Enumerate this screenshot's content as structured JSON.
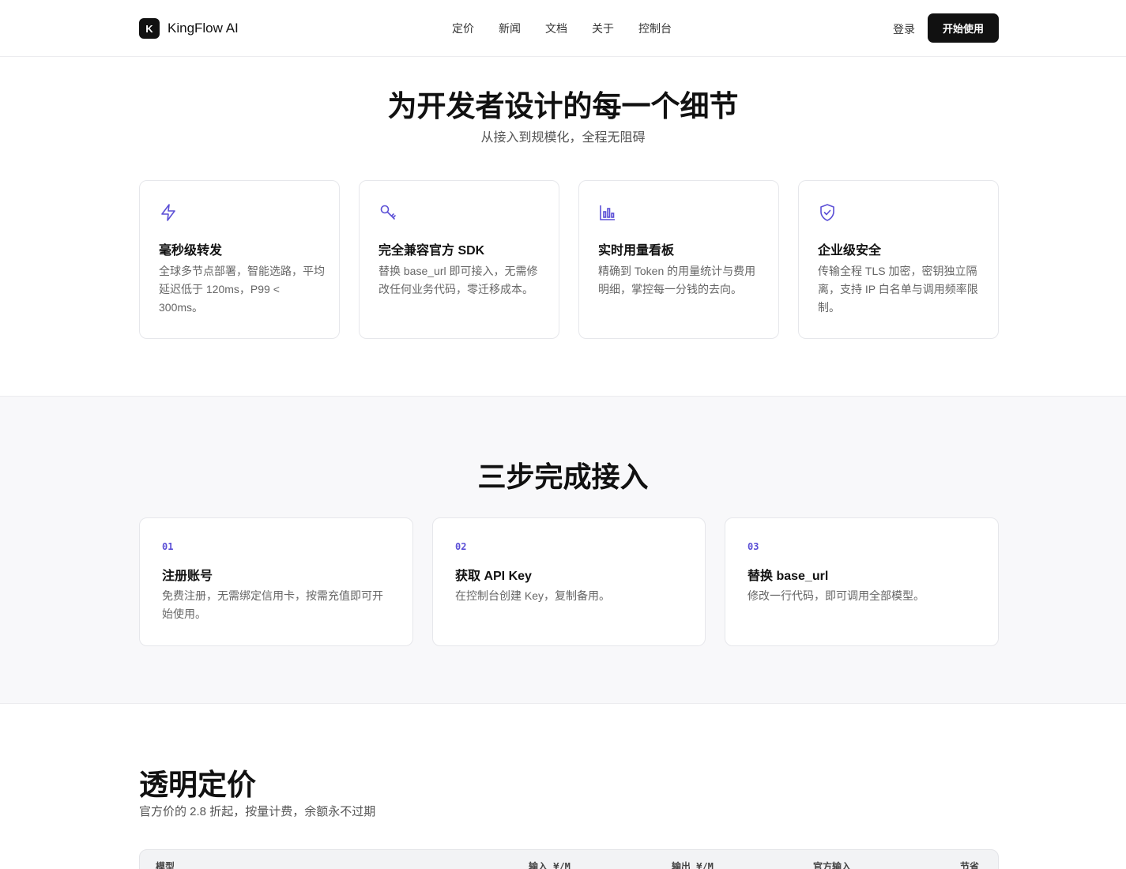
{
  "brand": {
    "mark": "K",
    "name": "KingFlow AI"
  },
  "nav": [
    "定价",
    "新闻",
    "文档",
    "关于",
    "控制台"
  ],
  "header": {
    "login": "登录",
    "cta": "开始使用"
  },
  "features": {
    "title": "为开发者设计的每一个细节",
    "subtitle": "从接入到规模化，全程无阻碍",
    "cards": [
      {
        "icon": "lightning-icon",
        "title": "毫秒级转发",
        "desc": "全球多节点部署，智能选路，平均延迟低于 120ms，P99 < 300ms。"
      },
      {
        "icon": "key-icon",
        "title": "完全兼容官方 SDK",
        "desc": "替换 base_url 即可接入，无需修改任何业务代码，零迁移成本。"
      },
      {
        "icon": "bar-chart-icon",
        "title": "实时用量看板",
        "desc": "精确到 Token 的用量统计与费用明细，掌控每一分钱的去向。"
      },
      {
        "icon": "shield-check-icon",
        "title": "企业级安全",
        "desc": "传输全程 TLS 加密，密钥独立隔离，支持 IP 白名单与调用频率限制。"
      }
    ]
  },
  "steps": {
    "title": "三步完成接入",
    "items": [
      {
        "num": "01",
        "title": "注册账号",
        "desc": "免费注册，无需绑定信用卡，按需充值即可开始使用。"
      },
      {
        "num": "02",
        "title": "获取 API Key",
        "desc": "在控制台创建 Key，复制备用。"
      },
      {
        "num": "03",
        "title": "替换 base_url",
        "desc": "修改一行代码，即可调用全部模型。"
      }
    ]
  },
  "pricing": {
    "title": "透明定价",
    "subtitle": "官方价的 2.8 折起，按量计费，余额永不过期",
    "columns": [
      "模型",
      "输入 ¥/M",
      "输出 ¥/M",
      "官方输入",
      "节省"
    ]
  },
  "colors": {
    "accent": "#5b4fd6",
    "dark": "#111111",
    "muted": "#666666"
  }
}
